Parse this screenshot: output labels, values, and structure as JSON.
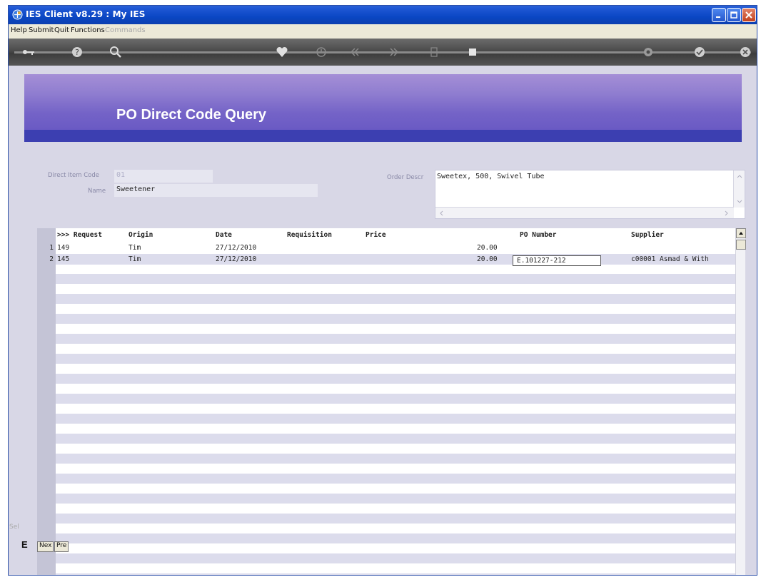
{
  "window": {
    "title": "IES Client v8.29 : My IES"
  },
  "menu": {
    "items": [
      "Help",
      "Submit",
      "Quit",
      "Functions",
      "Commands"
    ]
  },
  "toolbar": {
    "icons": [
      "key-icon",
      "help-icon",
      "search-icon",
      "heart-icon",
      "clock-icon",
      "rewind-icon",
      "forward-icon",
      "doc-icon",
      "square-icon",
      "settings-icon",
      "ok-icon",
      "close-icon"
    ]
  },
  "page": {
    "title": "PO Direct Code Query"
  },
  "form": {
    "direct_item_code_label": "Direct Item Code",
    "direct_item_code_value": "01",
    "name_label": "Name",
    "name_value": "Sweetener",
    "order_descr_label": "Order Descr",
    "order_descr_value": "Sweetex, 500, Swivel Tube"
  },
  "grid": {
    "columns": [
      ">>> Request",
      "Origin",
      "Date",
      "Requisition",
      "Price",
      "PO Number",
      "Supplier"
    ],
    "rows": [
      {
        "num": "1",
        "request": "149",
        "origin": "Tim",
        "date": "27/12/2010",
        "requisition": "",
        "price": "20.00",
        "po_number": "",
        "supplier": ""
      },
      {
        "num": "2",
        "request": "145",
        "origin": "Tim",
        "date": "27/12/2010",
        "requisition": "",
        "price": "20.00",
        "po_number": "E.101227-212",
        "supplier": "c00001 Asmad & With"
      }
    ]
  },
  "footer": {
    "side_label": "Sel",
    "glyph": "E",
    "next_button": "Nex",
    "prev_button": "Pre"
  },
  "colors": {
    "banner": "#8f7dd0",
    "banner_band": "#3c3fb1",
    "content_bg": "#d8d7e6",
    "stripe": "#dcdcec"
  }
}
